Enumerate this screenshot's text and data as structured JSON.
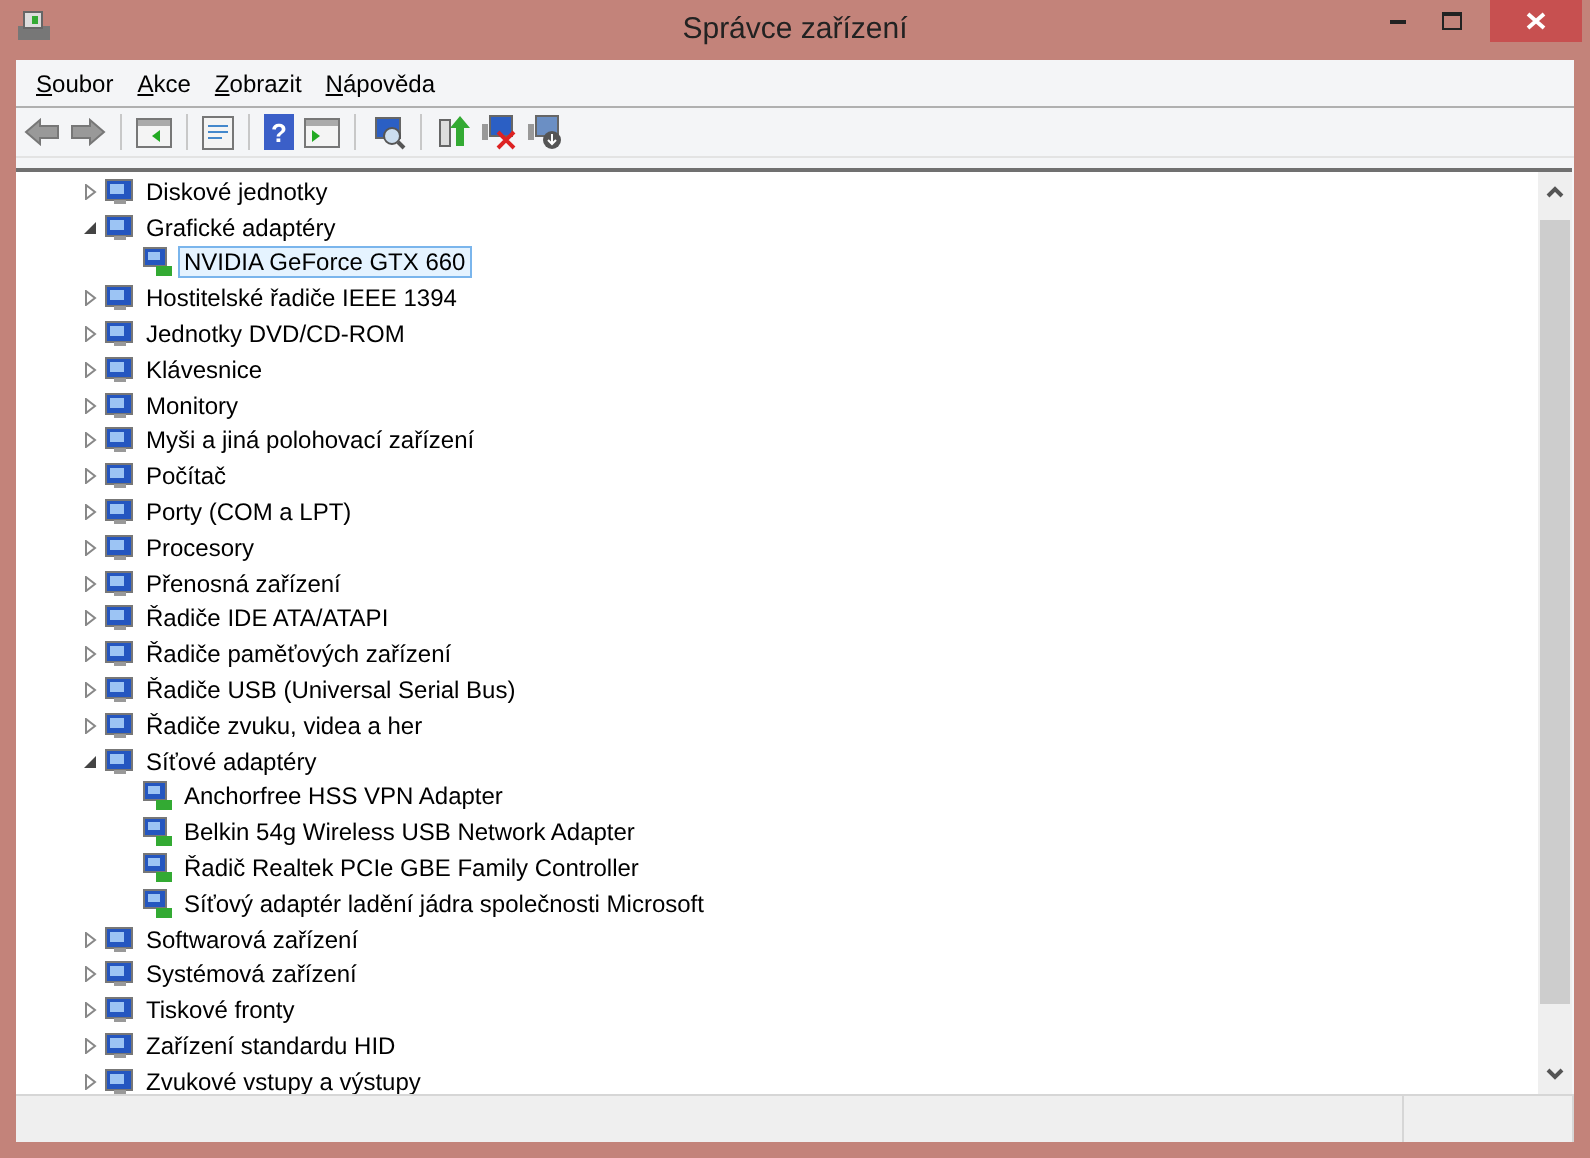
{
  "window": {
    "title": "Správce zařízení"
  },
  "toolbar": {
    "help_glyph": "?"
  },
  "menu": [
    {
      "label": "Soubor"
    },
    {
      "label": "Akce"
    },
    {
      "label": "Zobrazit"
    },
    {
      "label": "Nápověda"
    }
  ],
  "tree": [
    {
      "label": "Diskové jednotky",
      "expanded": false,
      "selected": false
    },
    {
      "label": "Grafické adaptéry",
      "expanded": true,
      "selected": false,
      "children": [
        {
          "label": "NVIDIA GeForce GTX 660",
          "selected": true
        }
      ]
    },
    {
      "label": "Hostitelské řadiče IEEE 1394",
      "expanded": false,
      "selected": false
    },
    {
      "label": "Jednotky DVD/CD-ROM",
      "expanded": false,
      "selected": false
    },
    {
      "label": "Klávesnice",
      "expanded": false,
      "selected": false
    },
    {
      "label": "Monitory",
      "expanded": false,
      "selected": false
    },
    {
      "label": "Myši a jiná polohovací zařízení",
      "expanded": false,
      "selected": false
    },
    {
      "label": "Počítač",
      "expanded": false,
      "selected": false
    },
    {
      "label": "Porty (COM a LPT)",
      "expanded": false,
      "selected": false
    },
    {
      "label": "Procesory",
      "expanded": false,
      "selected": false
    },
    {
      "label": "Přenosná zařízení",
      "expanded": false,
      "selected": false
    },
    {
      "label": "Řadiče IDE ATA/ATAPI",
      "expanded": false,
      "selected": false
    },
    {
      "label": "Řadiče paměťových zařízení",
      "expanded": false,
      "selected": false
    },
    {
      "label": "Řadiče USB (Universal Serial Bus)",
      "expanded": false,
      "selected": false
    },
    {
      "label": "Řadiče zvuku, videa a her",
      "expanded": false,
      "selected": false
    },
    {
      "label": "Síťové adaptéry",
      "expanded": true,
      "selected": false,
      "children": [
        {
          "label": "Anchorfree HSS VPN Adapter",
          "selected": false
        },
        {
          "label": "Belkin 54g Wireless USB Network Adapter",
          "selected": false
        },
        {
          "label": "Řadič Realtek PCIe GBE Family Controller",
          "selected": false
        },
        {
          "label": "Síťový adaptér ladění jádra společnosti Microsoft",
          "selected": false
        }
      ]
    },
    {
      "label": "Softwarová zařízení",
      "expanded": false,
      "selected": false
    },
    {
      "label": "Systémová zařízení",
      "expanded": false,
      "selected": false
    },
    {
      "label": "Tiskové fronty",
      "expanded": false,
      "selected": false
    },
    {
      "label": "Zařízení standardu HID",
      "expanded": false,
      "selected": false
    },
    {
      "label": "Zvukové vstupy a výstupy",
      "expanded": false,
      "selected": false
    }
  ]
}
